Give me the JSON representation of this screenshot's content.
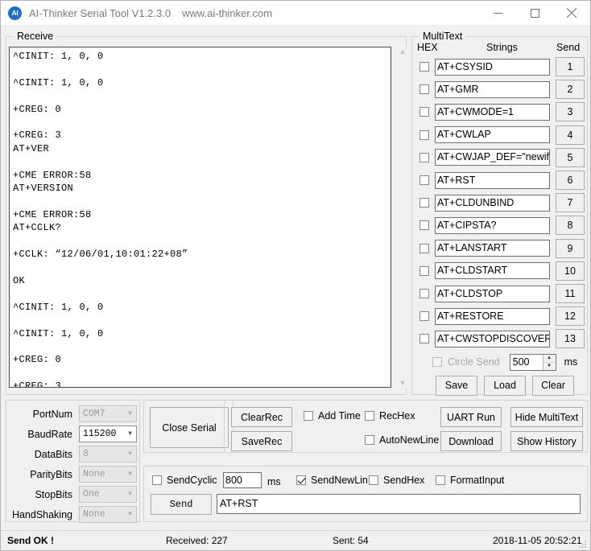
{
  "window": {
    "title": "AI-Thinker Serial Tool V1.2.3.0",
    "url": "www.ai-thinker.com",
    "icon_label": "AI",
    "minimize_icon": "minimize-icon",
    "maximize_icon": "maximize-icon",
    "close_icon": "close-icon"
  },
  "receive": {
    "group_label": "Receive",
    "text": "^CINIT: 1, 0, 0\n\n^CINIT: 1, 0, 0\n\n+CREG: 0\n\n+CREG: 3\nAT+VER\n\n+CME ERROR:58\nAT+VERSION\n\n+CME ERROR:58\nAT+CCLK?\n\n+CCLK: “12/06/01,10:01:22+08”\n\nOK\n\n^CINIT: 1, 0, 0\n\n^CINIT: 1, 0, 0\n\n+CREG: 0\n\n+CREG: 3",
    "scroll_up_icon": "chevron-up-icon",
    "scroll_down_icon": "chevron-down-icon"
  },
  "multitext": {
    "group_label": "MultiText",
    "col_hex": "HEX",
    "col_strings": "Strings",
    "col_send": "Send",
    "rows": [
      {
        "hex_checked": false,
        "value": "AT+CSYSID",
        "send": "1"
      },
      {
        "hex_checked": false,
        "value": "AT+GMR",
        "send": "2"
      },
      {
        "hex_checked": false,
        "value": "AT+CWMODE=1",
        "send": "3"
      },
      {
        "hex_checked": false,
        "value": "AT+CWLAP",
        "send": "4"
      },
      {
        "hex_checked": false,
        "value": "AT+CWJAP_DEF=\"newifi_",
        "send": "5"
      },
      {
        "hex_checked": false,
        "value": "AT+RST",
        "send": "6"
      },
      {
        "hex_checked": false,
        "value": "AT+CLDUNBIND",
        "send": "7"
      },
      {
        "hex_checked": false,
        "value": "AT+CIPSTA?",
        "send": "8"
      },
      {
        "hex_checked": false,
        "value": "AT+LANSTART",
        "send": "9"
      },
      {
        "hex_checked": false,
        "value": "AT+CLDSTART",
        "send": "10"
      },
      {
        "hex_checked": false,
        "value": "AT+CLDSTOP",
        "send": "11"
      },
      {
        "hex_checked": false,
        "value": "AT+RESTORE",
        "send": "12"
      },
      {
        "hex_checked": false,
        "value": "AT+CWSTOPDISCOVER",
        "send": "13"
      }
    ],
    "circle_send_label": "Circle Send",
    "circle_send_checked": false,
    "circle_send_interval": "500",
    "ms_label": "ms",
    "save_label": "Save",
    "load_label": "Load",
    "clear_label": "Clear"
  },
  "port": {
    "rows": [
      {
        "label": "PortNum",
        "value": "COM7",
        "enabled": false,
        "mono": true
      },
      {
        "label": "BaudRate",
        "value": "115200",
        "enabled": true,
        "mono": true
      },
      {
        "label": "DataBits",
        "value": "8",
        "enabled": false,
        "mono": true
      },
      {
        "label": "ParityBits",
        "value": "None",
        "enabled": false,
        "mono": true
      },
      {
        "label": "StopBits",
        "value": "One",
        "enabled": false,
        "mono": true
      },
      {
        "label": "HandShaking",
        "value": "None",
        "enabled": false,
        "mono": true
      }
    ],
    "dropdown_icon": "chevron-down-icon"
  },
  "controls": {
    "close_serial": "Close Serial",
    "clear_rec": "ClearRec",
    "save_rec": "SaveRec",
    "add_time_label": "Add Time",
    "add_time_checked": false,
    "rec_hex_label": "RecHex",
    "rec_hex_checked": false,
    "auto_newline_label": "AutoNewLine",
    "auto_newline_checked": false,
    "uart_run": "UART Run",
    "download": "Download",
    "hide_multitext": "Hide MultiText",
    "show_history": "Show History"
  },
  "send": {
    "send_cyclic_label": "SendCyclic",
    "send_cyclic_checked": false,
    "cyclic_interval": "800",
    "ms_label": "ms",
    "send_newline_label": "SendNewLin",
    "send_newline_checked": true,
    "send_hex_label": "SendHex",
    "send_hex_checked": false,
    "format_input_label": "FormatInput",
    "format_input_checked": false,
    "send_button": "Send",
    "input_value": "AT+RST"
  },
  "status": {
    "message": "Send OK !",
    "received": "Received: 227",
    "sent": "Sent: 54",
    "datetime": "2018-11-05 20:52:21"
  }
}
